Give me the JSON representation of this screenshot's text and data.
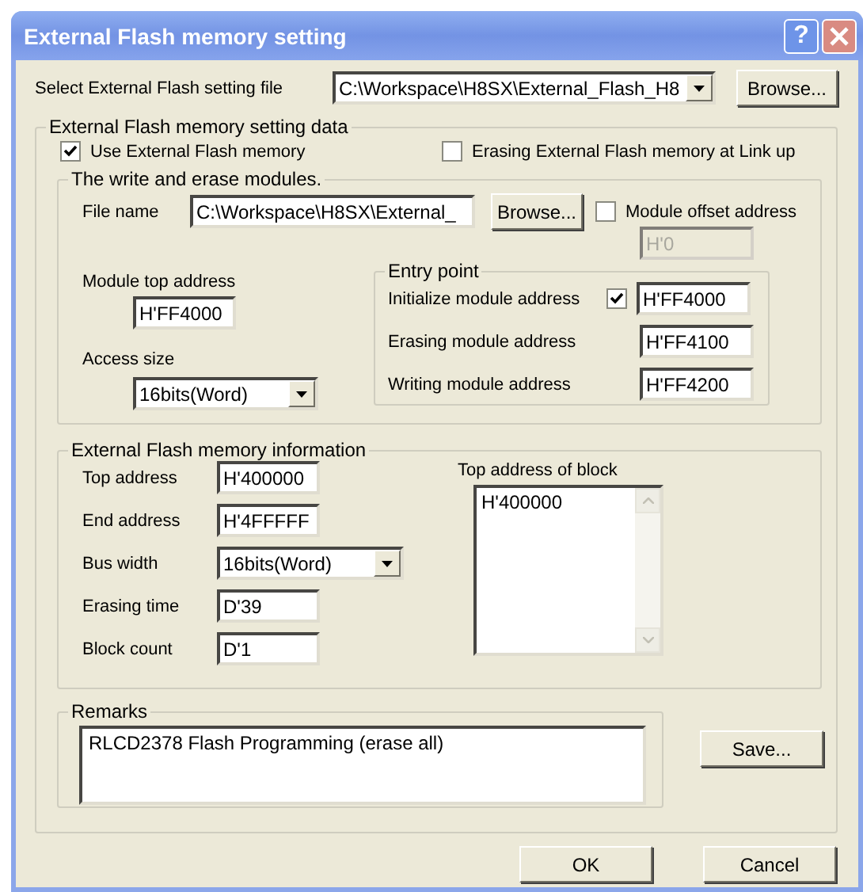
{
  "window": {
    "title": "External Flash memory setting",
    "help_button": "?"
  },
  "setting_file": {
    "label": "Select External Flash setting file",
    "value": "C:\\Workspace\\H8SX\\External_Flash_H8",
    "browse": "Browse..."
  },
  "setting_data": {
    "legend": "External Flash memory setting data",
    "options": [
      {
        "label": "Use External Flash memory",
        "checked": true
      },
      {
        "label": "Erasing External Flash memory at Link up",
        "checked": false
      }
    ],
    "modules": {
      "legend": "The write and erase modules.",
      "file_label": "File name",
      "file_value": "C:\\Workspace\\H8SX\\External_",
      "browse": "Browse...",
      "offset": {
        "label": "Module offset address",
        "checked": false,
        "value": "H'0",
        "disabled": true
      },
      "top_address": {
        "label": "Module top address",
        "value": "H'FF4000"
      },
      "access_size": {
        "label": "Access size",
        "value": "16bits(Word)"
      },
      "entry_point": {
        "legend": "Entry point",
        "rows": [
          {
            "label": "Initialize module address",
            "value": "H'FF4000",
            "kind": "checkbox",
            "checked": true
          },
          {
            "label": "Erasing module address",
            "value": "H'FF4100",
            "kind": "plain"
          },
          {
            "label": "Writing module address",
            "value": "H'FF4200",
            "kind": "plain"
          }
        ]
      }
    },
    "info": {
      "legend": "External Flash memory information",
      "fields": [
        {
          "label": "Top address",
          "value": "H'400000",
          "kind": "text"
        },
        {
          "label": "End address",
          "value": "H'4FFFFF",
          "kind": "text"
        },
        {
          "label": "Bus width",
          "value": "16bits(Word)",
          "kind": "combo"
        },
        {
          "label": "Erasing time",
          "value": "D'39",
          "kind": "text"
        },
        {
          "label": "Block count",
          "value": "D'1",
          "kind": "text"
        }
      ],
      "block_list": {
        "label": "Top address of block",
        "items": [
          "H'400000"
        ]
      }
    },
    "remarks": {
      "legend": "Remarks",
      "value": "RLCD2378 Flash Programming (erase all)"
    },
    "save": "Save..."
  },
  "buttons": [
    "OK",
    "Cancel"
  ]
}
